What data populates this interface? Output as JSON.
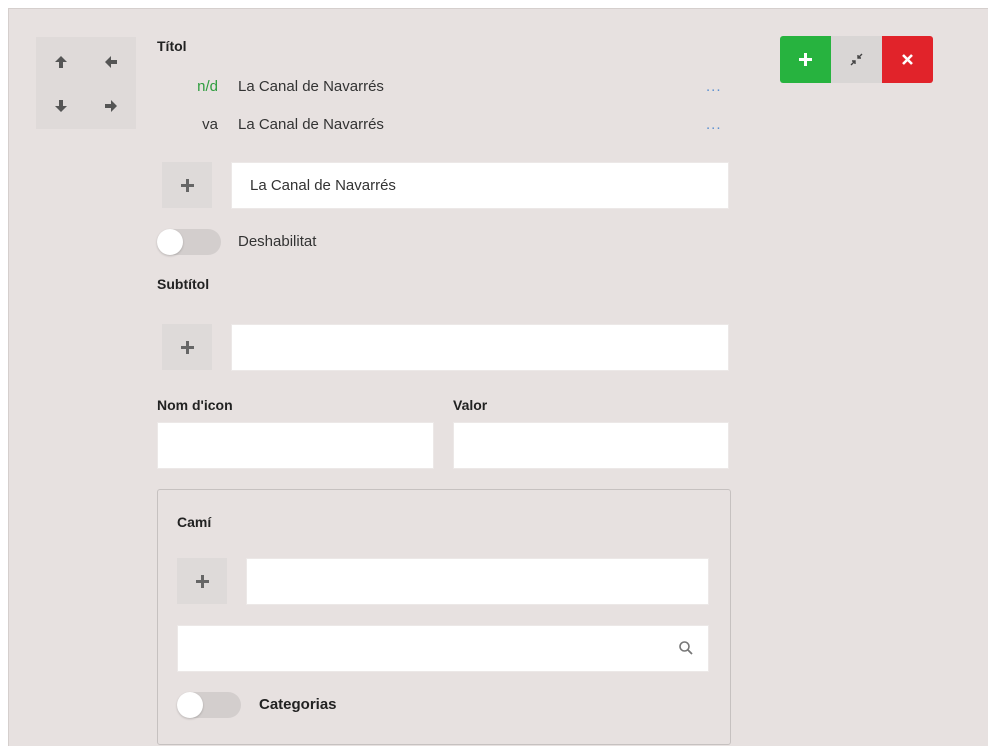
{
  "title_field": {
    "label": "Títol",
    "translations": [
      {
        "lang": "n/d",
        "text": "La Canal de Navarrés",
        "more": "..."
      },
      {
        "lang": "va",
        "text": "La Canal de Navarrés",
        "more": "..."
      }
    ],
    "value": "La Canal de Navarrés",
    "toggle_label": "Deshabilitat"
  },
  "subtitle_field": {
    "label": "Subtítol",
    "value": ""
  },
  "icon_name_field": {
    "label": "Nom d'icon",
    "value": ""
  },
  "value_field": {
    "label": "Valor",
    "value": ""
  },
  "path_group": {
    "label": "Camí",
    "value": "",
    "search_value": "",
    "toggle_label": "Categorias"
  },
  "actions": {
    "add": "plus-icon",
    "minimize": "compress-icon",
    "delete": "close-icon"
  },
  "colors": {
    "add": "#27b33f",
    "delete": "#e1232a",
    "lang_highlight": "#2e9d3e",
    "link": "#5b8fd0"
  }
}
